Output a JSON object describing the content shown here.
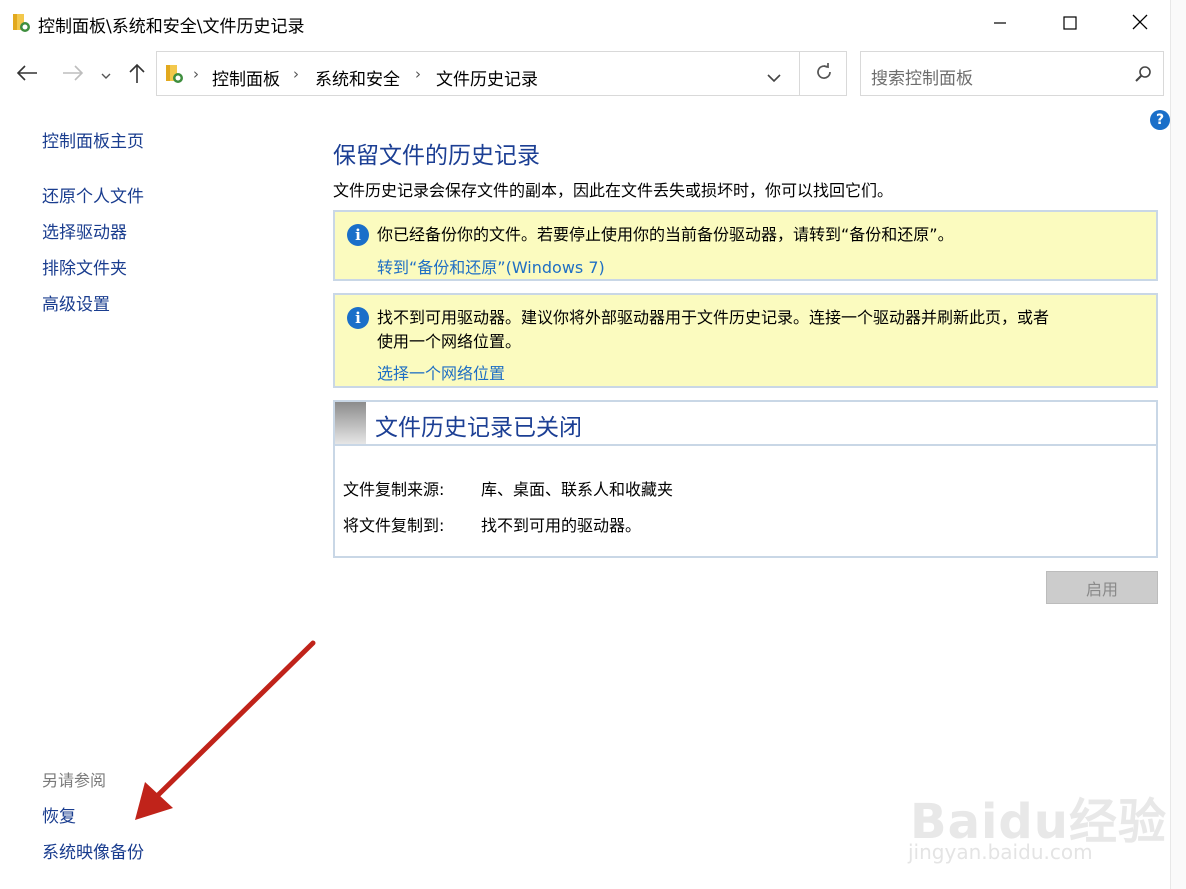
{
  "window": {
    "title": "控制面板\\系统和安全\\文件历史记录",
    "controls": {
      "minimize": "—",
      "maximize": "☐",
      "close": "✕"
    }
  },
  "nav": {
    "back_icon": "arrow-left-icon",
    "forward_icon": "arrow-right-icon",
    "recent_icon": "chevron-down-icon",
    "up_icon": "arrow-up-icon",
    "breadcrumb": [
      "控制面板",
      "系统和安全",
      "文件历史记录"
    ],
    "separator": "›",
    "refresh_icon": "refresh-icon",
    "search_placeholder": "搜索控制面板"
  },
  "help": {
    "label": "?"
  },
  "sidebar": {
    "home": "控制面板主页",
    "items": [
      "还原个人文件",
      "选择驱动器",
      "排除文件夹",
      "高级设置"
    ],
    "see_also_header": "另请参阅",
    "see_also": [
      "恢复",
      "系统映像备份"
    ]
  },
  "main": {
    "heading": "保留文件的历史记录",
    "description": "文件历史记录会保存文件的副本，因此在文件丢失或损坏时，你可以找回它们。",
    "info1": {
      "icon": "i",
      "text": "你已经备份你的文件。若要停止使用你的当前备份驱动器，请转到“备份和还原”。",
      "link": "转到“备份和还原”(Windows 7)"
    },
    "info2": {
      "icon": "i",
      "line1": "找不到可用驱动器。建议你将外部驱动器用于文件历史记录。连接一个驱动器并刷新此页，或者",
      "line2": "使用一个网络位置。",
      "link": "选择一个网络位置"
    },
    "status": {
      "title": "文件历史记录已关闭",
      "source_label": "文件复制来源:",
      "source_value": "库、桌面、联系人和收藏夹",
      "dest_label": "将文件复制到:",
      "dest_value": "找不到可用的驱动器。"
    },
    "enable_button": "启用"
  },
  "watermark": {
    "main": "Baidu经验",
    "sub": "jingyan.baidu.com"
  },
  "colors": {
    "link": "#1a3d8f",
    "heading": "#1c3f94",
    "info_bg": "#fbfbbf",
    "info_icon": "#1a6fc9",
    "annotation_arrow": "#c0231a"
  }
}
